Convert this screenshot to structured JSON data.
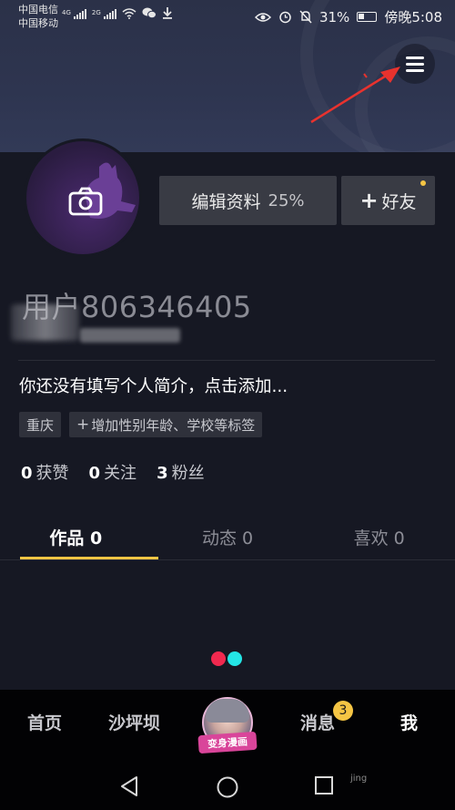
{
  "status_bar": {
    "carrier1": "中国电信",
    "carrier2": "中国移动",
    "net1": "4G",
    "net2": "2G",
    "battery_pct": "31%",
    "time": "傍晚5:08"
  },
  "profile": {
    "edit_label": "编辑资料",
    "edit_pct": "25%",
    "add_friend_label": "好友",
    "username": "用户806346405",
    "bio": "你还没有填写个人简介，点击添加...",
    "tags": [
      "重庆",
      "增加性别年龄、学校等标签"
    ],
    "stats": [
      {
        "value": "0",
        "label": "获赞"
      },
      {
        "value": "0",
        "label": "关注"
      },
      {
        "value": "3",
        "label": "粉丝"
      }
    ]
  },
  "tabs": [
    {
      "label": "作品 0",
      "active": true
    },
    {
      "label": "动态 0",
      "active": false
    },
    {
      "label": "喜欢 0",
      "active": false
    }
  ],
  "bottom_nav": {
    "items": [
      "首页",
      "沙坪坝",
      "消息",
      "我"
    ],
    "center_label": "变身漫画",
    "msg_badge": "3"
  },
  "watermark": "jing",
  "colors": {
    "accent": "#f5c544",
    "background": "#161823",
    "loader_red": "#f0294f",
    "loader_cyan": "#24e5e5"
  },
  "icons": [
    "menu-icon",
    "camera-icon",
    "plus-icon",
    "back-icon",
    "home-icon",
    "recent-apps-icon"
  ]
}
